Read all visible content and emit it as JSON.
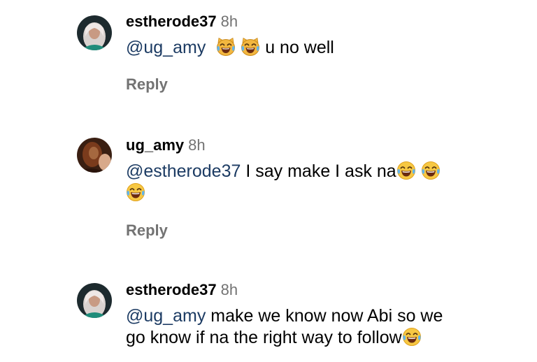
{
  "comments": [
    {
      "username": "estherode37",
      "time": "8h",
      "mention": "@ug_amy",
      "emoji_before": [
        "crying-laughing-cat-emoji",
        "crying-laughing-cat-emoji"
      ],
      "text": "u no well",
      "reply_label": "Reply"
    },
    {
      "username": "ug_amy",
      "time": "8h",
      "mention": "@estherode37",
      "text": "I say make I ask na",
      "emoji_after": [
        "tears-of-joy-emoji",
        "tears-of-joy-emoji",
        "tears-of-joy-emoji"
      ],
      "reply_label": "Reply"
    },
    {
      "username": "estherode37",
      "time": "8h",
      "mention": "@ug_amy",
      "text_line1": "make we know now Abi so we",
      "text_line2": "go know if na the right way to follow",
      "emoji_after": [
        "tears-of-joy-emoji"
      ]
    }
  ],
  "colors": {
    "mention": "#1c3b63",
    "secondary_text": "#737373",
    "background": "#ffffff"
  }
}
